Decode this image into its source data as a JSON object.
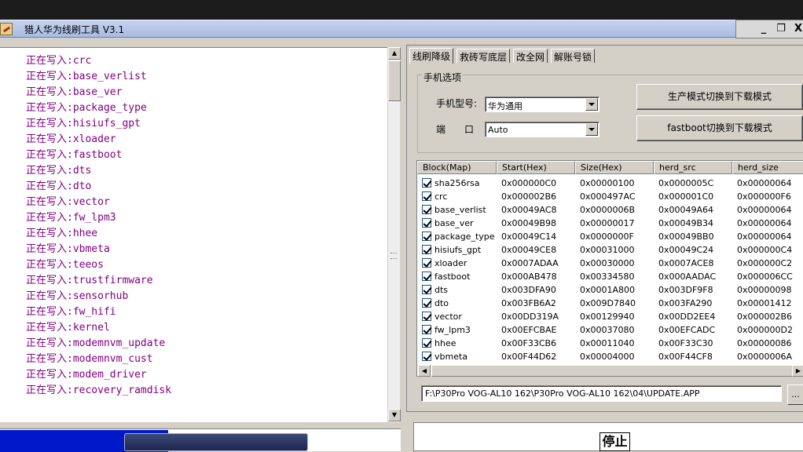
{
  "window": {
    "title": "猎人华为线刷工具 V3.1",
    "minimize": "_",
    "restore": "❐",
    "close": "X"
  },
  "log": {
    "lines": [
      "正在写入:crc",
      "正在写入:base_verlist",
      "正在写入:base_ver",
      "正在写入:package_type",
      "正在写入:hisiufs_gpt",
      "正在写入:xloader",
      "正在写入:fastboot",
      "正在写入:dts",
      "正在写入:dto",
      "正在写入:vector",
      "正在写入:fw_lpm3",
      "正在写入:hhee",
      "正在写入:vbmeta",
      "正在写入:teeos",
      "正在写入:trustfirmware",
      "正在写入:sensorhub",
      "正在写入:fw_hifi",
      "正在写入:kernel",
      "正在写入:modemnvm_update",
      "正在写入:modemnvm_cust",
      "正在写入:modem_driver",
      "正在写入:recovery_ramdisk"
    ],
    "progress": 0.42
  },
  "tabs": [
    "线刷降级",
    "救砖写底层",
    "改全网",
    "解账号锁"
  ],
  "phone_options": {
    "legend": "手机选项",
    "model_label": "手机型号:",
    "model_value": "华为通用",
    "port_label": "端　　口",
    "port_value": "Auto"
  },
  "buttons": {
    "prod_to_download": "生产模式切换到下载模式",
    "fastboot_to_download": "fastboot切换到下载模式",
    "stop": "停止",
    "browse": "..."
  },
  "table": {
    "columns": [
      "Block(Map)",
      "Start(Hex)",
      "Size(Hex)",
      "herd_src",
      "herd_size"
    ],
    "rows": [
      {
        "checked": true,
        "name": "sha256rsa",
        "start": "0x000000C0",
        "size": "0x00000100",
        "src": "0x0000005C",
        "hsize": "0x00000064"
      },
      {
        "checked": true,
        "name": "crc",
        "start": "0x000002B6",
        "size": "0x000497AC",
        "src": "0x000001C0",
        "hsize": "0x000000F6"
      },
      {
        "checked": true,
        "name": "base_verlist",
        "start": "0x00049AC8",
        "size": "0x0000006B",
        "src": "0x00049A64",
        "hsize": "0x00000064"
      },
      {
        "checked": true,
        "name": "base_ver",
        "start": "0x00049B98",
        "size": "0x00000017",
        "src": "0x00049B34",
        "hsize": "0x00000064"
      },
      {
        "checked": true,
        "name": "package_type",
        "start": "0x00049C14",
        "size": "0x0000000F",
        "src": "0x00049BB0",
        "hsize": "0x00000064"
      },
      {
        "checked": true,
        "name": "hisiufs_gpt",
        "start": "0x00049CE8",
        "size": "0x00031000",
        "src": "0x00049C24",
        "hsize": "0x000000C4"
      },
      {
        "checked": true,
        "name": "xloader",
        "start": "0x0007ADAA",
        "size": "0x00030000",
        "src": "0x0007ACE8",
        "hsize": "0x000000C2"
      },
      {
        "checked": true,
        "name": "fastboot",
        "start": "0x000AB478",
        "size": "0x00334580",
        "src": "0x000AADAC",
        "hsize": "0x000006CC"
      },
      {
        "checked": true,
        "name": "dts",
        "start": "0x003DFA90",
        "size": "0x0001A800",
        "src": "0x003DF9F8",
        "hsize": "0x00000098"
      },
      {
        "checked": true,
        "name": "dto",
        "start": "0x003FB6A2",
        "size": "0x009D7840",
        "src": "0x003FA290",
        "hsize": "0x00001412"
      },
      {
        "checked": true,
        "name": "vector",
        "start": "0x00DD319A",
        "size": "0x00129940",
        "src": "0x00DD2EE4",
        "hsize": "0x000002B6"
      },
      {
        "checked": true,
        "name": "fw_lpm3",
        "start": "0x00EFCBAE",
        "size": "0x00037080",
        "src": "0x00EFCADC",
        "hsize": "0x000000D2"
      },
      {
        "checked": true,
        "name": "hhee",
        "start": "0x00F33CB6",
        "size": "0x00011040",
        "src": "0x00F33C30",
        "hsize": "0x00000086"
      },
      {
        "checked": true,
        "name": "vbmeta",
        "start": "0x00F44D62",
        "size": "0x00004000",
        "src": "0x00F44CF8",
        "hsize": "0x0000006A"
      }
    ]
  },
  "file_path": "F:\\P30Pro VOG-AL10 162\\P30Pro VOG-AL10 162\\04\\UPDATE.APP"
}
